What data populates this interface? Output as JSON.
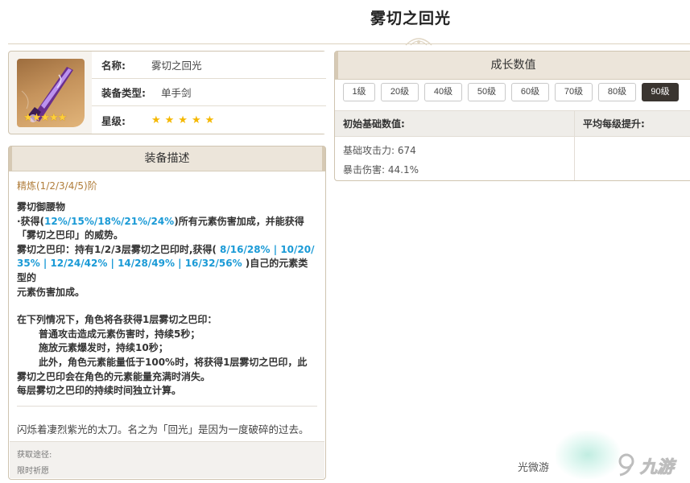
{
  "page": {
    "title": "雾切之回光"
  },
  "info": {
    "name_label": "名称:",
    "name_value": "雾切之回光",
    "type_label": "装备类型:",
    "type_value": "单手剑",
    "star_label": "星级:",
    "stars": "★★★★★",
    "image_stars": "★★★★★"
  },
  "description": {
    "header": "装备描述",
    "refine": "精炼(1/2/3/4/5)阶",
    "title": "雾切御腰物",
    "line1_a": "·获得(",
    "line1_b": "12%/15%/18%/21%/24%",
    "line1_c": ")所有元素伤害加成，并能获得",
    "line2": "「雾切之巴印」的威势。",
    "line3_a": "雾切之巴印：持有1/2/3层雾切之巴印时,获得(",
    "line3_b": " 8/16/28% | 10/20/",
    "line4_a": "35% | 12/24/42% | 14/28/49% | 16/32/56%",
    "line4_b": " )自己的元素类型的",
    "line5": "元素伤害加成。",
    "line6": "在下列情况下，角色将各获得1层雾切之巴印：",
    "line7": "普通攻击造成元素伤害时，持续5秒；",
    "line8": "施放元素爆发时，持续10秒；",
    "line9": "此外，角色元素能量低于100%时，将获得1层雾切之巴印，此",
    "line10": "雾切之巴印会在角色的元素能量充满时消失。",
    "line11": "每层雾切之巴印的持续时间独立计算。",
    "flavor": "闪烁着凄烈紫光的太刀。名之为「回光」是因为一度破碎的过去。",
    "obtain_label": "获取途径:",
    "obtain_value": "限时祈愿"
  },
  "growth": {
    "header": "成长数值",
    "levels": [
      "1级",
      "20级",
      "40级",
      "50级",
      "60级",
      "70级",
      "80级",
      "90级"
    ],
    "active_level": "90级",
    "col_base": "初始基础数值:",
    "col_avg": "平均每级提升:",
    "base_atk": "基础攻击力: 674",
    "crit_dmg": "暴击伤害: 44.1%"
  },
  "watermark": {
    "small": "光微游",
    "logo": "九游"
  }
}
